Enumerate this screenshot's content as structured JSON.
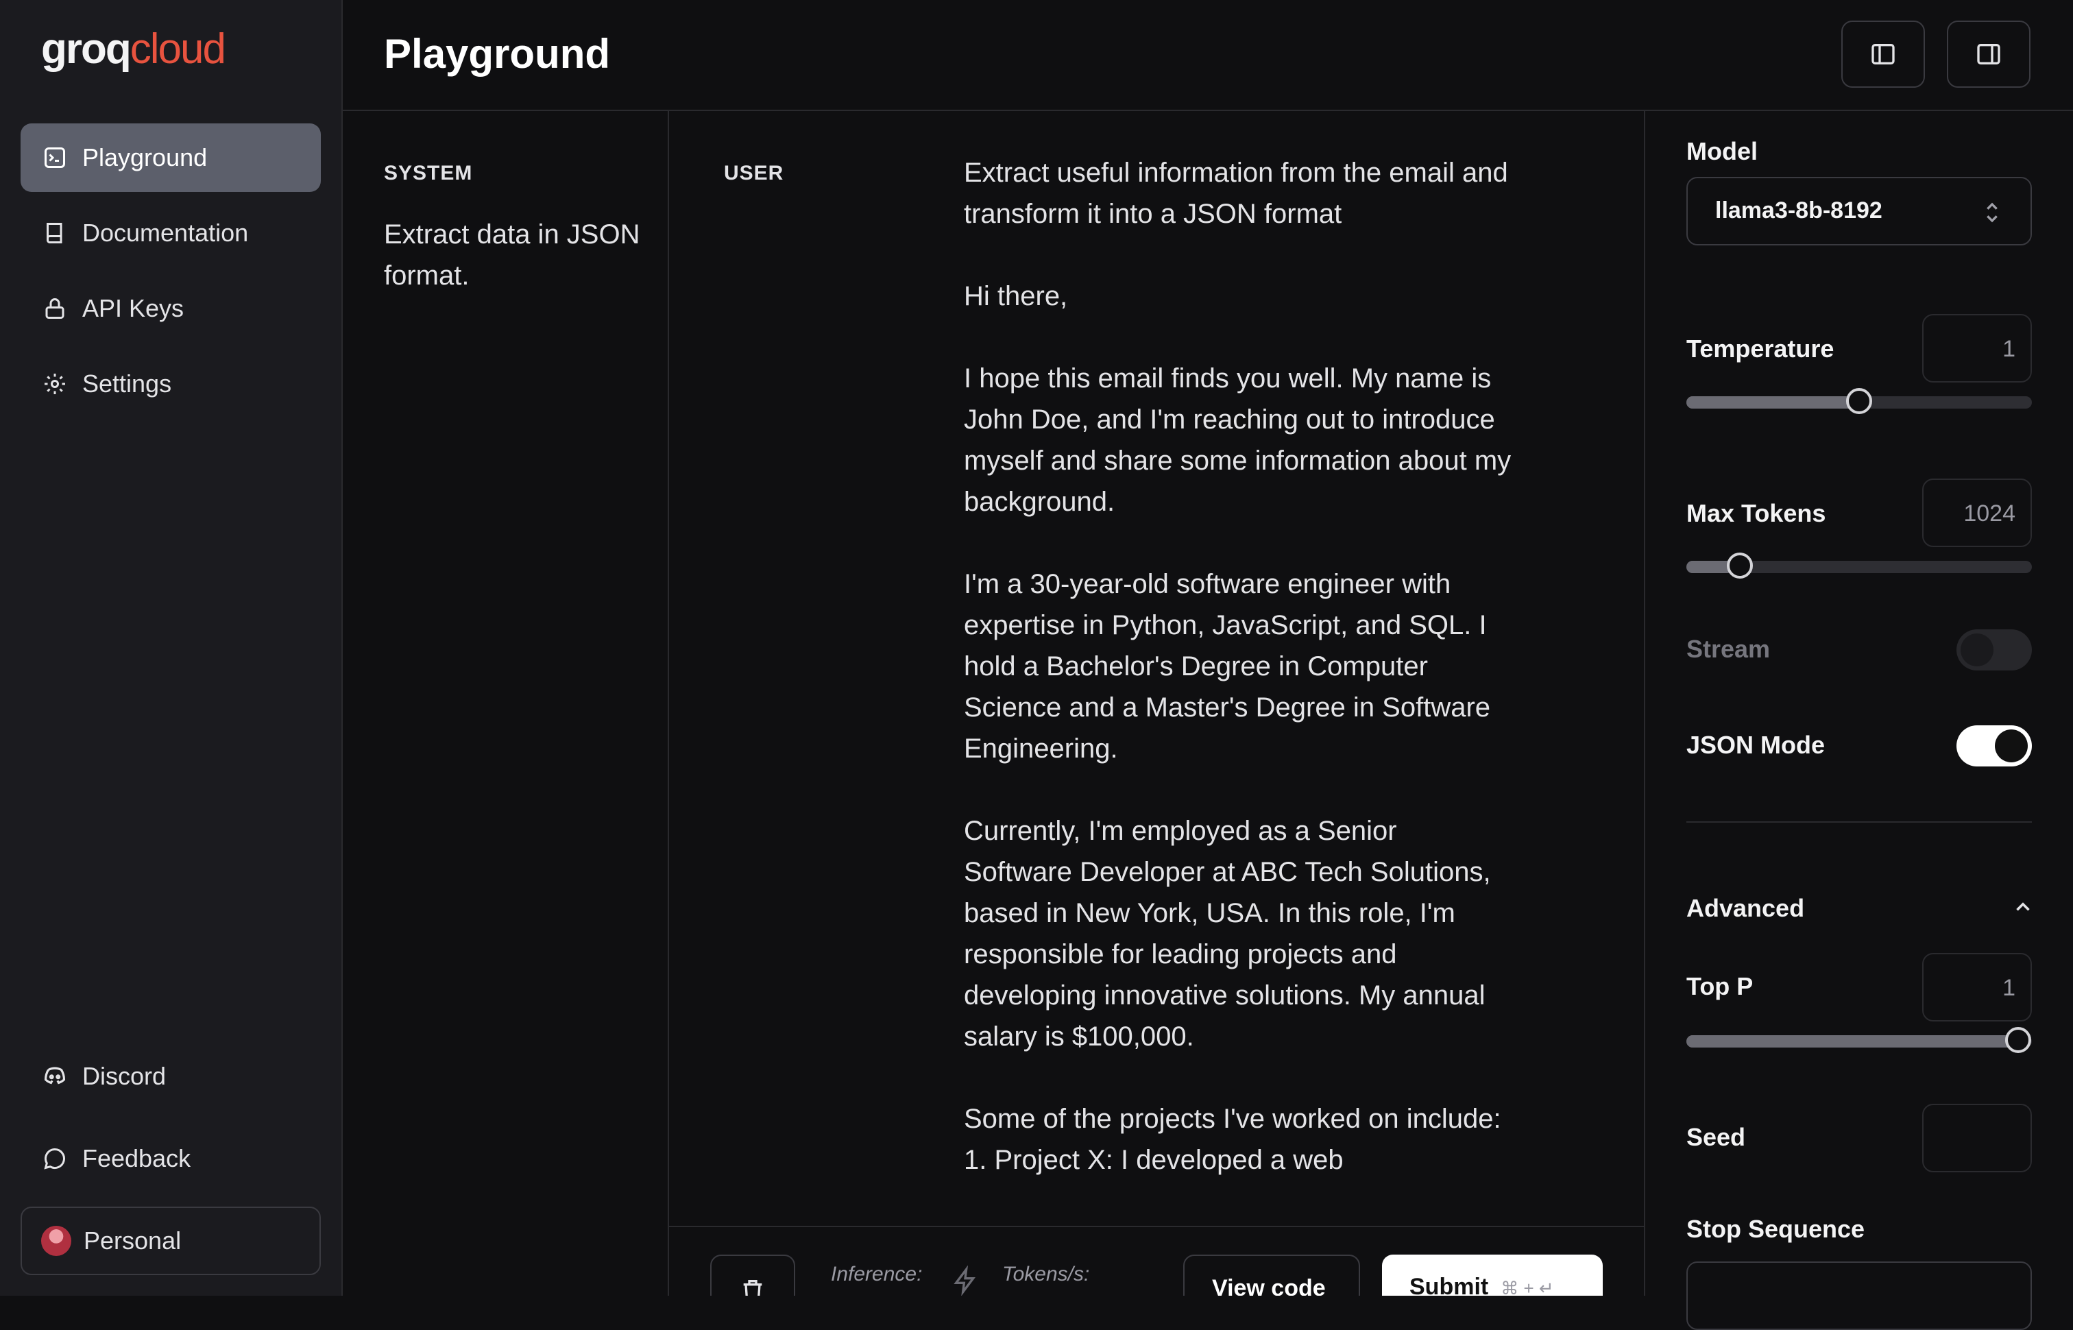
{
  "brand": {
    "part1": "groq",
    "part2": "cloud"
  },
  "sidebar": {
    "items": [
      {
        "label": "Playground",
        "icon": "terminal-icon",
        "active": true
      },
      {
        "label": "Documentation",
        "icon": "book-icon"
      },
      {
        "label": "API Keys",
        "icon": "lock-icon"
      },
      {
        "label": "Settings",
        "icon": "gear-icon"
      }
    ],
    "bottom": [
      {
        "label": "Discord",
        "icon": "discord-icon"
      },
      {
        "label": "Feedback",
        "icon": "chat-bubble-icon"
      },
      {
        "label": "Personal",
        "icon": "avatar"
      }
    ]
  },
  "header": {
    "title": "Playground"
  },
  "system": {
    "label": "SYSTEM",
    "text": "Extract data in JSON format."
  },
  "user": {
    "label": "USER",
    "text": "Extract useful information from the email and transform it into a JSON format\n\nHi there,\n\nI hope this email finds you well. My name is John Doe, and I'm reaching out to introduce myself and share some information about my background.\n\nI'm a 30-year-old software engineer with expertise in Python, JavaScript, and SQL. I hold a Bachelor's Degree in Computer Science and a Master's Degree in Software Engineering.\n\nCurrently, I'm employed as a Senior Software Developer at ABC Tech Solutions, based in New York, USA. In this role, I'm responsible for leading projects and developing innovative solutions. My annual salary is $100,000.\n\nSome of the projects I've worked on include:\n1. Project X: I developed a web"
  },
  "footer": {
    "inference_label": "Inference:",
    "tokens_label": "Tokens/s:",
    "view_code": "View code",
    "submit": "Submit",
    "shortcut": "⌘ + ↵"
  },
  "settings": {
    "model_label": "Model",
    "model_value": "llama3-8b-8192",
    "temperature_label": "Temperature",
    "temperature_value": "1",
    "temperature_fraction": 0.5,
    "max_tokens_label": "Max Tokens",
    "max_tokens_value": "1024",
    "max_tokens_fraction": 0.155,
    "stream_label": "Stream",
    "stream_on": false,
    "json_mode_label": "JSON Mode",
    "json_mode_on": true,
    "advanced_label": "Advanced",
    "top_p_label": "Top P",
    "top_p_value": "1",
    "top_p_fraction": 0.96,
    "seed_label": "Seed",
    "seed_value": "",
    "stop_sequence_label": "Stop Sequence"
  },
  "colors": {
    "accent": "#e8533f",
    "active_nav": "#5c5f6b"
  }
}
